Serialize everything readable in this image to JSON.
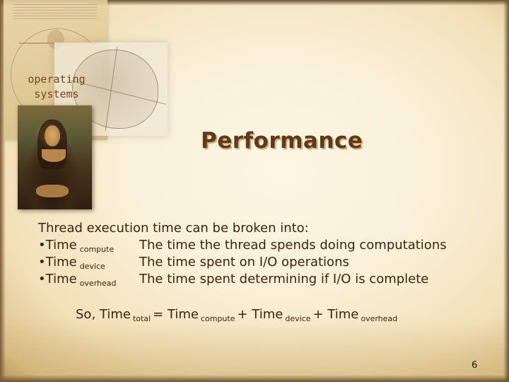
{
  "slide": {
    "course_label": [
      "operating",
      "systems"
    ],
    "title": "Performance",
    "intro": "Thread execution time can be broken into:",
    "terms": [
      {
        "bullet": "•",
        "term": "Time",
        "subscript": "compute",
        "description": "The time the thread spends doing computations"
      },
      {
        "bullet": "•",
        "term": "Time",
        "subscript": "device",
        "description": "The time spent on I/O operations"
      },
      {
        "bullet": "•",
        "term": "Time",
        "subscript": "overhead",
        "description": "The time spent determining if I/O is complete"
      }
    ],
    "formula": {
      "prefix": "So, Time",
      "total_sub": "total",
      "equals": "= Time",
      "compute_sub": "compute",
      "plus1": "+ Time",
      "device_sub": "device",
      "plus2": "+ Time",
      "overhead_sub": "overhead"
    },
    "page_number": "6",
    "images": [
      "vitruvian-man-sketch",
      "brain-anatomy-sketch",
      "mona-lisa-painting"
    ]
  }
}
